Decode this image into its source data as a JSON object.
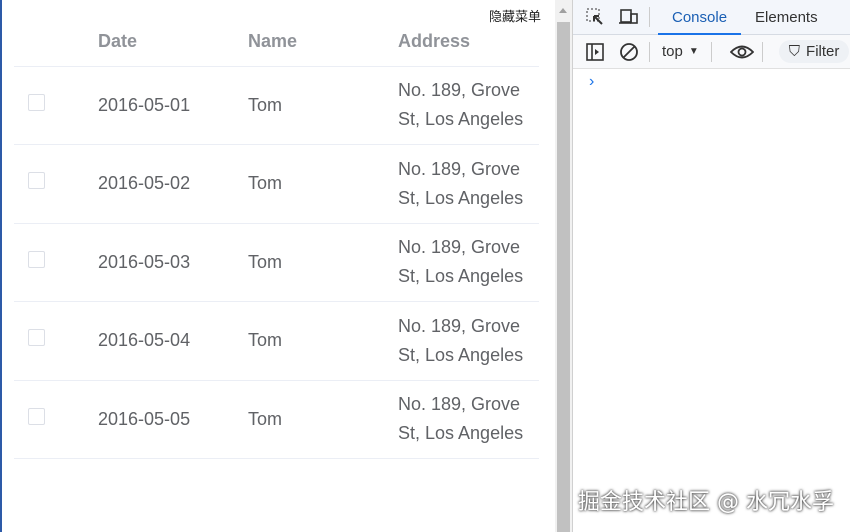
{
  "hide_menu_label": "隐藏菜单",
  "table": {
    "headers": [
      "Date",
      "Name",
      "Address"
    ],
    "rows": [
      {
        "date": "2016-05-01",
        "name": "Tom",
        "address": "No. 189, Grove St, Los Angeles"
      },
      {
        "date": "2016-05-02",
        "name": "Tom",
        "address": "No. 189, Grove St, Los Angeles"
      },
      {
        "date": "2016-05-03",
        "name": "Tom",
        "address": "No. 189, Grove St, Los Angeles"
      },
      {
        "date": "2016-05-04",
        "name": "Tom",
        "address": "No. 189, Grove St, Los Angeles"
      },
      {
        "date": "2016-05-05",
        "name": "Tom",
        "address": "No. 189, Grove St, Los Angeles"
      }
    ]
  },
  "devtools": {
    "tabs": [
      "Console",
      "Elements"
    ],
    "context": "top",
    "filter_placeholder": "Filter",
    "prompt": "›"
  },
  "watermark": "掘金技术社区 @ 水冗水孚"
}
